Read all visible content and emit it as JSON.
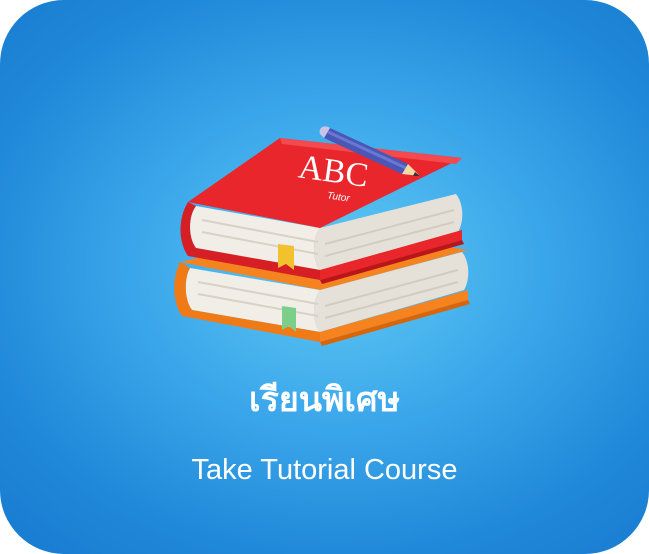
{
  "tile": {
    "title": "เรียนพิเศษ",
    "subtitle": "Take Tutorial Course",
    "book_cover_text": "ABC",
    "book_cover_subtext": "Tutor",
    "icon": "books-with-pencil-icon"
  },
  "colors": {
    "background": "#2a93de",
    "background_center": "#5fc9f3",
    "red_book": "#e8262b",
    "orange_book": "#f5831f",
    "pages": "#f1eee8",
    "pencil": "#4a57b6",
    "bookmark_yellow": "#f2c12e",
    "bookmark_green": "#7ccf8a",
    "text": "#ffffff"
  }
}
